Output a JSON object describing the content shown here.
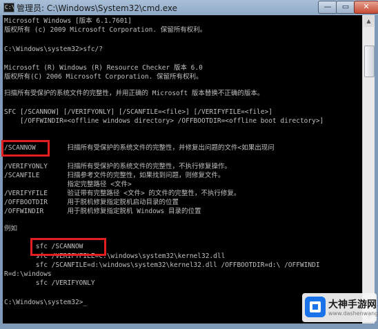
{
  "window": {
    "title": "管理员: C:\\Windows\\System32\\cmd.exe",
    "app_icon_text": "C:\\",
    "buttons": {
      "minimize": "—",
      "maximize": "▭",
      "close": "✕"
    }
  },
  "console_lines": [
    "Microsoft Windows [版本 6.1.7601]",
    "版权所有 (c) 2009 Microsoft Corporation. 保留所有权利。",
    "",
    "C:\\Windows\\system32>sfc/?",
    "",
    "Microsoft (R) Windows (R) Resource Checker 版本 6.0",
    "版权所有(C) 2006 Microsoft Corporation. 保留所有权利。",
    "",
    "扫描所有受保护的系统文件的完整性，并用正确的 Microsoft 版本替换不正确的版本。",
    "",
    "SFC [/SCANNOW] [/VERIFYONLY] [/SCANFILE=<file>] [/VERIFYFILE=<file>]",
    "    [/OFFWINDIR=<offline windows directory> /OFFBOOTDIR=<offline boot directory>]",
    "",
    "/SCANNOW        扫描所有受保护的系统文件的完整性，并修复出问题的文件<如果出现问",
    "",
    "/VERIFYONLY     扫描所有受保护的系统文件的完整性，不执行修复操作。",
    "/SCANFILE       扫描参考文件的完整性，如果找到问题，则修复文件。",
    "                指定完整路径 <文件>",
    "/VERIFYFILE     验证带有完整路径 <文件> 的文件的完整性，不执行修复。",
    "/OFFBOOTDIR     用于脱机修复指定脱机启动目录的位置",
    "/OFFWINDIR      用于脱机修复指定脱机 Windows 目录的位置",
    "",
    "例如",
    "",
    "        sfc /SCANNOW",
    "        sfc /VERIFYFILE=c:\\windows\\system32\\kernel32.dll",
    "        sfc /SCANFILE=d:\\windows\\system32\\kernel32.dll /OFFBOOTDIR=d:\\ /OFFWINDI",
    "R=d:\\windows",
    "        sfc /VERIFYONLY",
    "",
    "C:\\Windows\\system32>_"
  ],
  "scrollbar": {
    "up": "▲",
    "down": "▼"
  },
  "watermark": {
    "title": "大神手游网",
    "url": "www.dashenwang.com"
  }
}
